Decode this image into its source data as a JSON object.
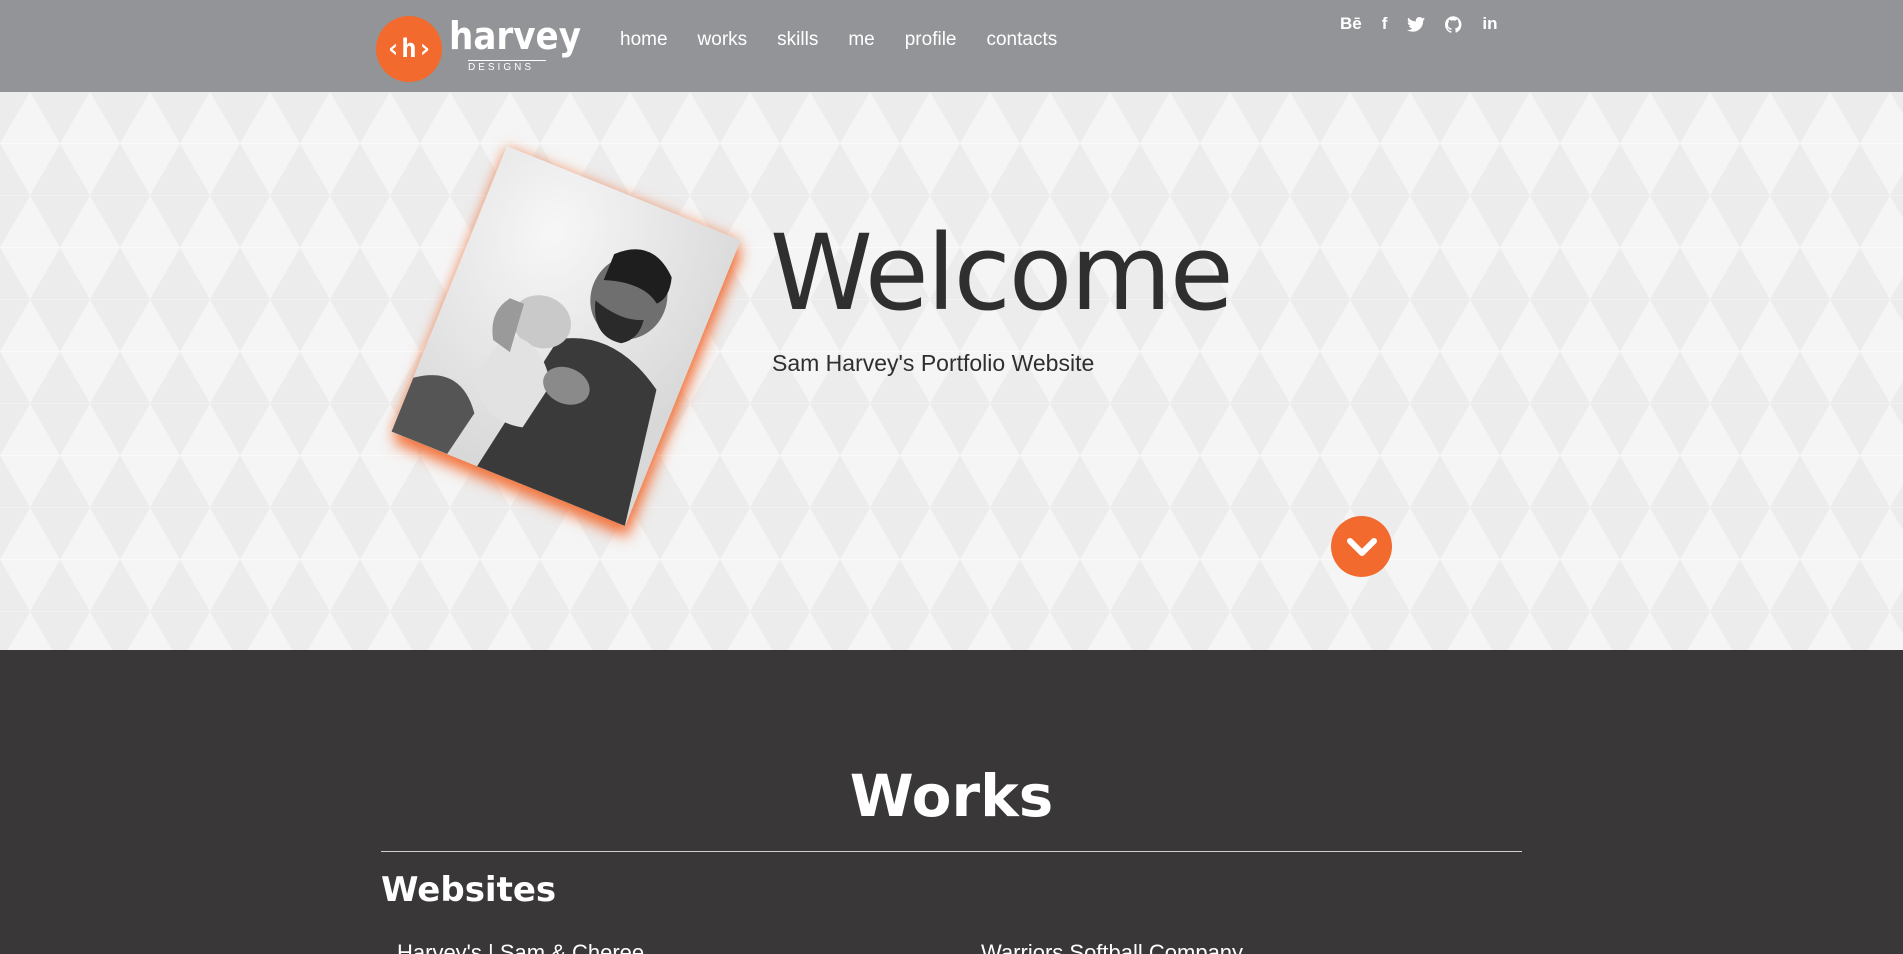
{
  "logo": {
    "mark": "‹h›",
    "word": "harvey",
    "sub": "DESIGNS"
  },
  "nav": [
    "home",
    "works",
    "skills",
    "me",
    "profile",
    "contacts"
  ],
  "social": [
    "behance-icon",
    "facebook-icon",
    "twitter-icon",
    "github-icon",
    "linkedin-icon"
  ],
  "social_labels": {
    "behance": "Bē",
    "linkedin": "in",
    "facebook": "f"
  },
  "hero": {
    "title": "Welcome",
    "subtitle": "Sam Harvey's Portfolio Website"
  },
  "works": {
    "title": "Works",
    "section": "Websites",
    "items": [
      "Harvey's | Sam & Cheree",
      "Warriors Softball Company"
    ]
  },
  "colors": {
    "accent": "#f26a2e",
    "header": "#939497",
    "dark": "#3a3738"
  }
}
